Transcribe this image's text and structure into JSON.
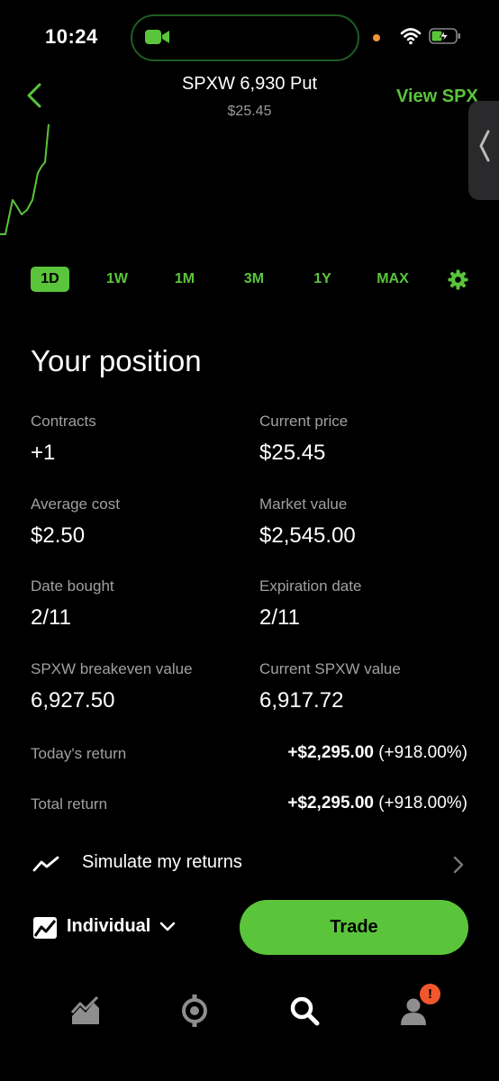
{
  "status_bar": {
    "time": "10:24"
  },
  "header": {
    "title": "SPXW 6,930 Put",
    "price": "$25.45",
    "view_link": "View SPX"
  },
  "chart": {
    "color": "#5ac53b",
    "series_shape": "rising line, partial view"
  },
  "ranges": [
    "1D",
    "1W",
    "1M",
    "3M",
    "1Y",
    "MAX"
  ],
  "active_range": "1D",
  "position": {
    "title": "Your position",
    "stats": [
      {
        "label": "Contracts",
        "value": "+1"
      },
      {
        "label": "Current price",
        "value": "$25.45"
      },
      {
        "label": "Average cost",
        "value": "$2.50"
      },
      {
        "label": "Market value",
        "value": "$2,545.00"
      },
      {
        "label": "Date bought",
        "value": "2/11"
      },
      {
        "label": "Expiration date",
        "value": "2/11"
      },
      {
        "label": "SPXW breakeven value",
        "value": "6,927.50"
      },
      {
        "label": "Current SPXW value",
        "value": "6,917.72"
      }
    ],
    "returns": [
      {
        "label": "Today's return",
        "amount": "+$2,295.00",
        "percent": "(+918.00%)"
      },
      {
        "label": "Total return",
        "amount": "+$2,295.00",
        "percent": "(+918.00%)"
      }
    ]
  },
  "simulate": {
    "label": "Simulate my returns"
  },
  "account": {
    "label": "Individual"
  },
  "trade_button": {
    "label": "Trade"
  },
  "tab_bar": {
    "items": [
      "investing-icon",
      "crypto-icon",
      "search-icon",
      "account-icon"
    ],
    "badge": "!"
  },
  "colors": {
    "accent": "#5ac53b",
    "badge": "#f1572c",
    "background": "#000000"
  }
}
